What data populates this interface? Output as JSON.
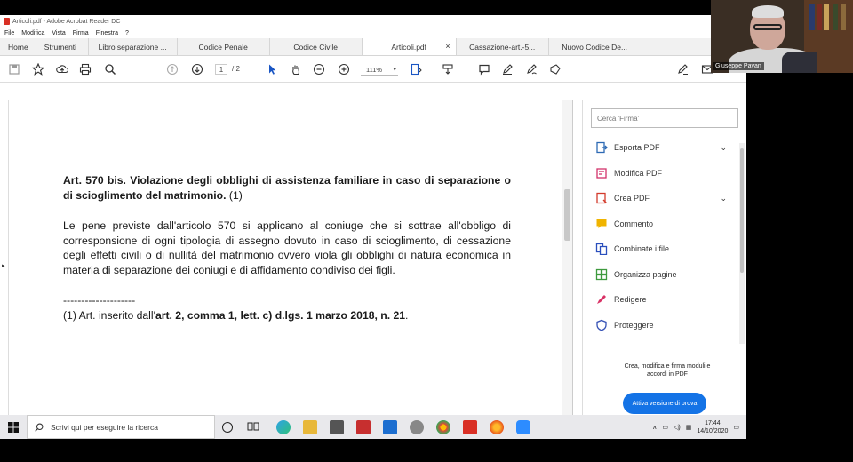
{
  "window": {
    "title": "Articoli.pdf - Adobe Acrobat Reader DC"
  },
  "menubar": {
    "items": [
      "File",
      "Modifica",
      "Vista",
      "Firma",
      "Finestra",
      "?"
    ]
  },
  "tabs": {
    "main": [
      "Home",
      "Strumenti"
    ],
    "documents": [
      {
        "label": "Libro separazione ...",
        "active": false
      },
      {
        "label": "Codice Penale",
        "active": false
      },
      {
        "label": "Codice Civile",
        "active": false
      },
      {
        "label": "Articoli.pdf",
        "active": true
      },
      {
        "label": "Cassazione-art.-5...",
        "active": false
      },
      {
        "label": "Nuovo Codice De...",
        "active": false
      }
    ],
    "close_glyph": "×"
  },
  "toolbar": {
    "page_current": "1",
    "page_total": "/ 2",
    "zoom": "111%"
  },
  "document": {
    "heading_bold": "Art. 570 bis. Violazione degli obblighi di assistenza familiare in caso di separazione o di scioglimento del matrimonio.",
    "heading_note": " (1)",
    "body": "Le pene previste dall'articolo 570 si applicano al coniuge che si sottrae all'obbligo di corresponsione di ogni tipologia di assegno dovuto in caso di scioglimento, di cessazione degli effetti civili o di nullità del matrimonio ovvero viola gli obblighi di natura economica in materia di separazione dei coniugi e di affidamento condiviso dei figli.",
    "separator": "--------------------",
    "footnote_prefix": "(1) Art. inserito dall'",
    "footnote_bold": "art. 2, comma 1, lett. c) d.lgs. 1 marzo 2018, n. 21",
    "footnote_suffix": "."
  },
  "right_panel": {
    "search_placeholder": "Cerca 'Firma'",
    "tools": [
      {
        "label": "Esporta PDF",
        "icon": "export-pdf-icon",
        "color": "#2d6ab4",
        "has_chevron": true
      },
      {
        "label": "Modifica PDF",
        "icon": "edit-pdf-icon",
        "color": "#d3336b",
        "has_chevron": false
      },
      {
        "label": "Crea PDF",
        "icon": "create-pdf-icon",
        "color": "#d33b2c",
        "has_chevron": true
      },
      {
        "label": "Commento",
        "icon": "comment-icon",
        "color": "#f0b400",
        "has_chevron": false
      },
      {
        "label": "Combinate i file",
        "icon": "combine-files-icon",
        "color": "#2a4fbd",
        "has_chevron": false
      },
      {
        "label": "Organizza pagine",
        "icon": "organize-pages-icon",
        "color": "#3e9a3e",
        "has_chevron": false
      },
      {
        "label": "Redigere",
        "icon": "redact-icon",
        "color": "#d93266",
        "has_chevron": false
      },
      {
        "label": "Proteggere",
        "icon": "protect-icon",
        "color": "#3551b5",
        "has_chevron": false
      }
    ],
    "promo_text": "Crea, modifica e firma moduli e accordi in PDF",
    "trial_button": "Attiva versione di prova"
  },
  "taskbar": {
    "search_text": "Scrivi qui per eseguire la ricerca",
    "time": "17:44",
    "date": "14/10/2020"
  },
  "webcam": {
    "name": "Giuseppe Pavan"
  },
  "colors": {
    "accent": "#1473e6",
    "taskbar": "#e9e9ec"
  }
}
